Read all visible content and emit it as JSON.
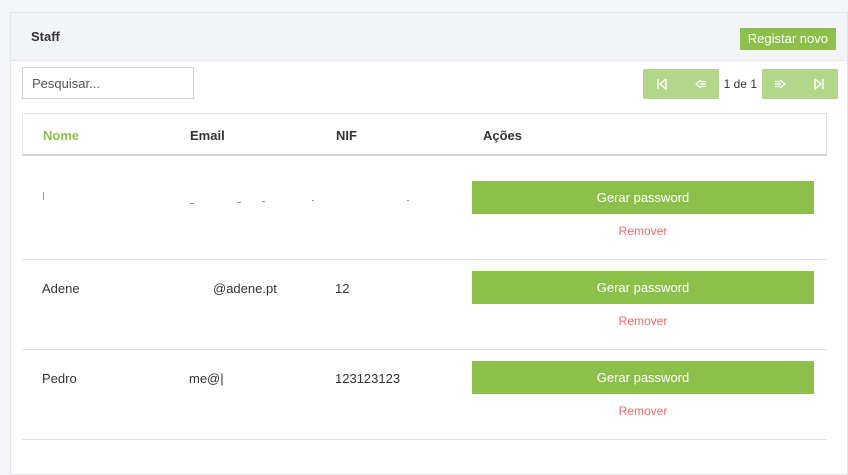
{
  "header": {
    "title": "Staff",
    "register_label": "Registar novo"
  },
  "search": {
    "placeholder": "Pesquisar..."
  },
  "pagination": {
    "info": "1 de 1",
    "first_icon": "first-page-icon",
    "prev_icon": "prev-page-icon",
    "next_icon": "next-page-icon",
    "last_icon": "last-page-icon"
  },
  "table": {
    "columns": [
      "Nome",
      "Email",
      "NIF",
      "Ações"
    ],
    "sorted_column": "Nome",
    "rows": [
      {
        "name": "",
        "email": "",
        "nif": "",
        "generate_label": "Gerar password",
        "remove_label": "Remover"
      },
      {
        "name": "Adene",
        "email": "@adene.pt",
        "nif": "12",
        "generate_label": "Gerar password",
        "remove_label": "Remover"
      },
      {
        "name": "Pedro",
        "email": "me@|",
        "nif": "123123123",
        "generate_label": "Gerar password",
        "remove_label": "Remover"
      }
    ]
  },
  "colors": {
    "accent": "#8cc04b",
    "accent_light": "#b2d68a",
    "danger": "#ec6b6b"
  }
}
